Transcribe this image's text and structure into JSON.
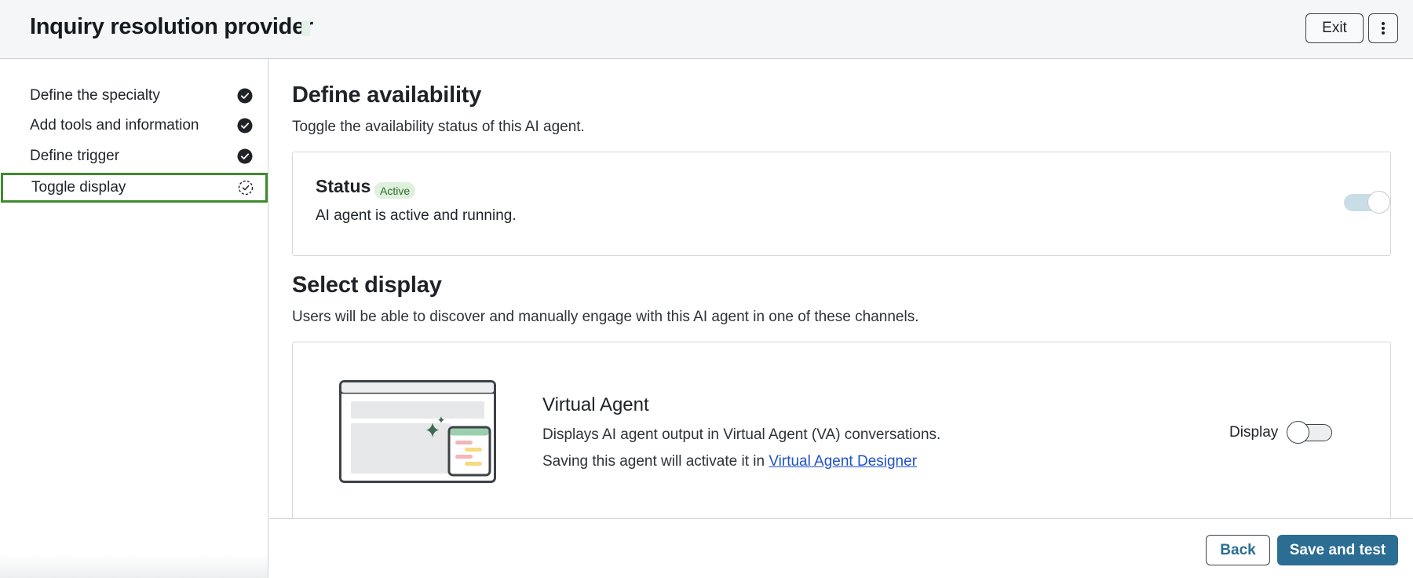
{
  "header": {
    "title": "Inquiry resolution provider",
    "exit_label": "Exit",
    "more_icon": "more-vertical-icon"
  },
  "sidebar": {
    "steps": [
      {
        "label": "Define the specialty",
        "status": "complete",
        "icon": "check-circle-icon"
      },
      {
        "label": "Add tools and information",
        "status": "complete",
        "icon": "check-circle-icon"
      },
      {
        "label": "Define trigger",
        "status": "complete",
        "icon": "check-circle-icon"
      },
      {
        "label": "Toggle display",
        "status": "in-progress",
        "icon": "in-progress-circle-icon"
      }
    ]
  },
  "availability": {
    "heading": "Define availability",
    "description": "Toggle the availability status of this AI agent.",
    "status_title": "Status",
    "status_badge": "Active",
    "status_description": "AI agent is active and running.",
    "toggle_on": true
  },
  "display": {
    "heading": "Select display",
    "description": "Users will be able to discover and manually engage with this AI agent in one of these channels.",
    "virtual_agent": {
      "title": "Virtual Agent",
      "description": "Displays AI agent output in Virtual Agent (VA) conversations.",
      "save_note_prefix": "Saving this agent will activate it in ",
      "save_note_link": "Virtual Agent Designer",
      "display_label": "Display",
      "toggle_on": false,
      "illustration": "virtual-agent-illustration"
    }
  },
  "footer": {
    "back_label": "Back",
    "save_label": "Save and test"
  },
  "colors": {
    "accent": "#2b6d93",
    "active_step_border": "#3f8a2f",
    "badge_bg": "#dff0de",
    "badge_text": "#2c6b27",
    "link": "#2052c9"
  }
}
